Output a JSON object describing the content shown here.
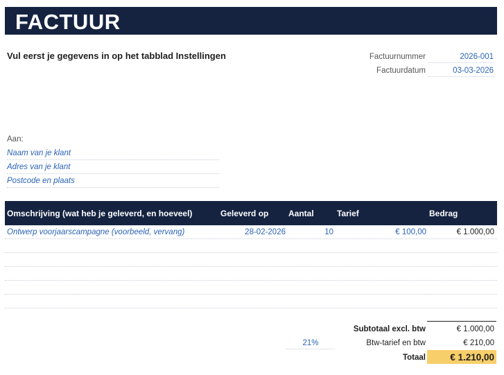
{
  "header": {
    "title": "FACTUUR"
  },
  "instruction": "Vul eerst je gegevens in op het tabblad Instellingen",
  "meta": {
    "invoice_number_label": "Factuurnummer",
    "invoice_number": "2026-001",
    "invoice_date_label": "Factuurdatum",
    "invoice_date": "03-03-2026"
  },
  "recipient": {
    "label": "Aan:",
    "name": "Naam van je klant",
    "address": "Adres van je klant",
    "city": "Postcode en plaats"
  },
  "table": {
    "headers": {
      "description": "Omschrijving (wat heb je geleverd, en hoeveel)",
      "delivered": "Geleverd op",
      "quantity": "Aantal",
      "rate": "Tarief",
      "amount": "Bedrag"
    },
    "rows": [
      {
        "description": "Ontwerp voorjaarscampagne (voorbeeld, vervang)",
        "delivered": "28-02-2026",
        "quantity": "10",
        "rate": "€ 100,00",
        "amount": "€ 1.000,00"
      }
    ]
  },
  "totals": {
    "subtotal_label": "Subtotaal excl. btw",
    "subtotal": "€ 1.000,00",
    "vat_rate": "21%",
    "vat_label": "Btw-tarief en btw",
    "vat": "€ 210,00",
    "total_label": "Totaal",
    "total": "€ 1.210,00"
  },
  "colors": {
    "navy": "#152341",
    "input_blue": "#2b63b7",
    "total_highlight": "#f7cf6a"
  }
}
